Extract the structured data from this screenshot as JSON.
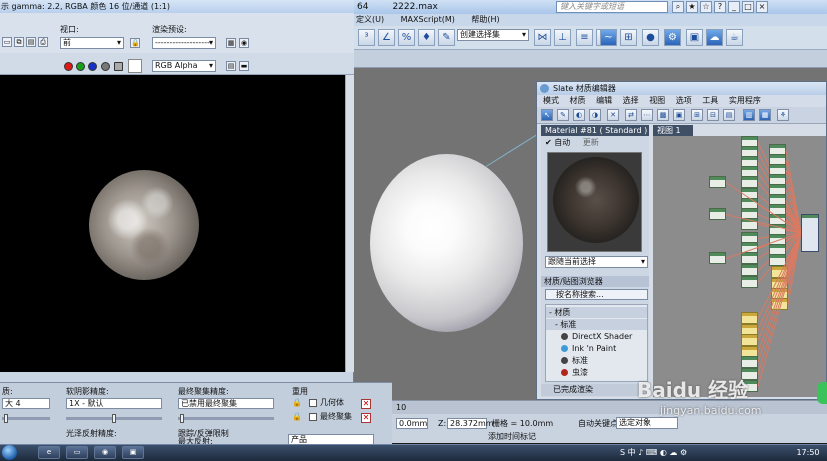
{
  "max_window": {
    "title_parts": [
      "64",
      "2222.max"
    ],
    "search_placeholder": "键入关键字或短语",
    "title_icons": [
      "⌕",
      "★",
      "☆",
      "?",
      "_",
      "□",
      "×"
    ],
    "menu": [
      "定义(U)",
      "MAXScript(M)",
      "帮助(H)"
    ],
    "selection_set": "创建选择集",
    "timeline_value": "10",
    "status": {
      "x_value": "0.0mm",
      "z_label": "Z:",
      "z_value": "28.372mm",
      "grid_label": "栅格 = 10.0mm",
      "auto_key": "自动关键点",
      "selected_object": "选定对象",
      "add_time_tag": "添加时间标记"
    }
  },
  "render_frame": {
    "title": "示 gamma: 2.2, RGBA 颜色 16 位/通道 (1:1)",
    "viewport_label": "视口:",
    "viewport_value": "前",
    "preset_label": "渲染预设:",
    "preset_value": "--------------------",
    "channel_value": "RGB Alpha",
    "settings": {
      "left_label": "质:",
      "left_value": "大 4",
      "soft_shadow_label": "软阴影精度:",
      "soft_shadow_value": "1X - 默认",
      "final_gather_label": "最终聚集精度:",
      "final_gather_value": "已禁用最终聚集",
      "reuse_label": "重用",
      "geometry_label": "几何体",
      "final_gather_cb_label": "最终聚集",
      "glossy_label": "光泽反射精度:",
      "trace_label": "跟踪/反弹限制",
      "max_reflection_label": "最大反射:",
      "product_value": "产品"
    }
  },
  "slate": {
    "title": "Slate 材质编辑器",
    "menu": [
      "模式",
      "材质",
      "编辑",
      "选择",
      "视图",
      "选项",
      "工具",
      "实用程序"
    ],
    "material_title": "Material #81  ( Standard )",
    "auto_label": "自动",
    "update_label": "更新",
    "preview_select": "跟随当前选择",
    "browser_header": "材质/贴图浏览器",
    "search_placeholder": "按名称搜索...",
    "list": [
      {
        "label": "- 材质",
        "color": "",
        "indent": 0
      },
      {
        "label": "- 标准",
        "color": "",
        "indent": 6
      },
      {
        "label": "DirectX Shader",
        "color": "#444444",
        "indent": 12
      },
      {
        "label": "Ink 'n Paint",
        "color": "#3f9ad8",
        "indent": 12
      },
      {
        "label": "标准",
        "color": "#444444",
        "indent": 12
      },
      {
        "label": "虫漆",
        "color": "#b0251c",
        "indent": 12
      }
    ],
    "status": "已完成渲染",
    "view_tab": "视图 1"
  },
  "taskbar": {
    "tray_text": "自动关键点  选定对象",
    "clock": "17:50"
  },
  "watermark": {
    "text": "Baidu 经验",
    "sub": "jingyan.baidu.com"
  }
}
